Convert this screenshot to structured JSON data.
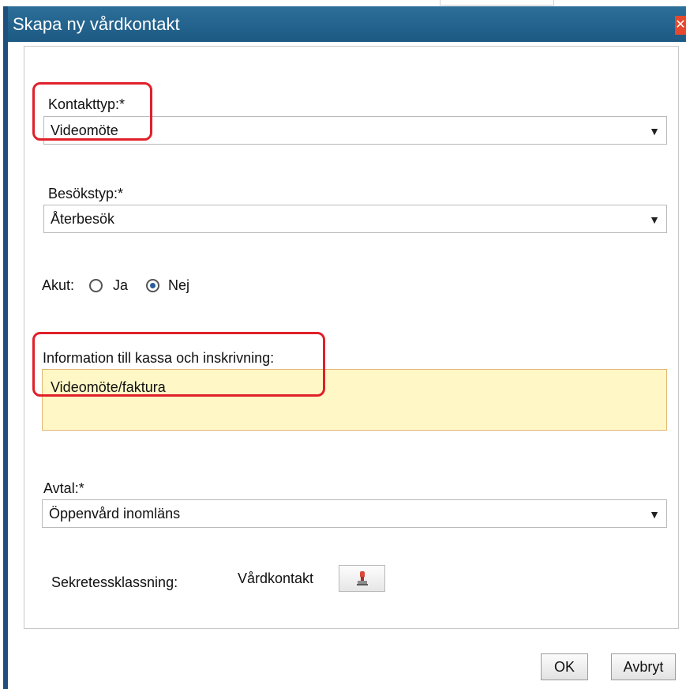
{
  "dialog": {
    "title": "Skapa ny vårdkontakt",
    "close_label": "✕"
  },
  "form": {
    "kontakttyp": {
      "label": "Kontakttyp:*",
      "value": "Videomöte"
    },
    "besokstyp": {
      "label": "Besökstyp:*",
      "value": "Återbesök"
    },
    "akut": {
      "label": "Akut:",
      "options": [
        {
          "label": "Ja",
          "selected": false
        },
        {
          "label": "Nej",
          "selected": true
        }
      ]
    },
    "information": {
      "label": "Information till kassa och inskrivning:",
      "value": "Videomöte/faktura"
    },
    "avtal": {
      "label": "Avtal:*",
      "value": "Öppenvård inomläns"
    },
    "sekretess": {
      "label": "Sekretessklassning:",
      "value": "Vårdkontakt",
      "button_icon": "stamp-icon"
    }
  },
  "buttons": {
    "ok": "OK",
    "cancel": "Avbryt"
  },
  "annotation_color": "#e0202a",
  "accent": "#1c5983"
}
